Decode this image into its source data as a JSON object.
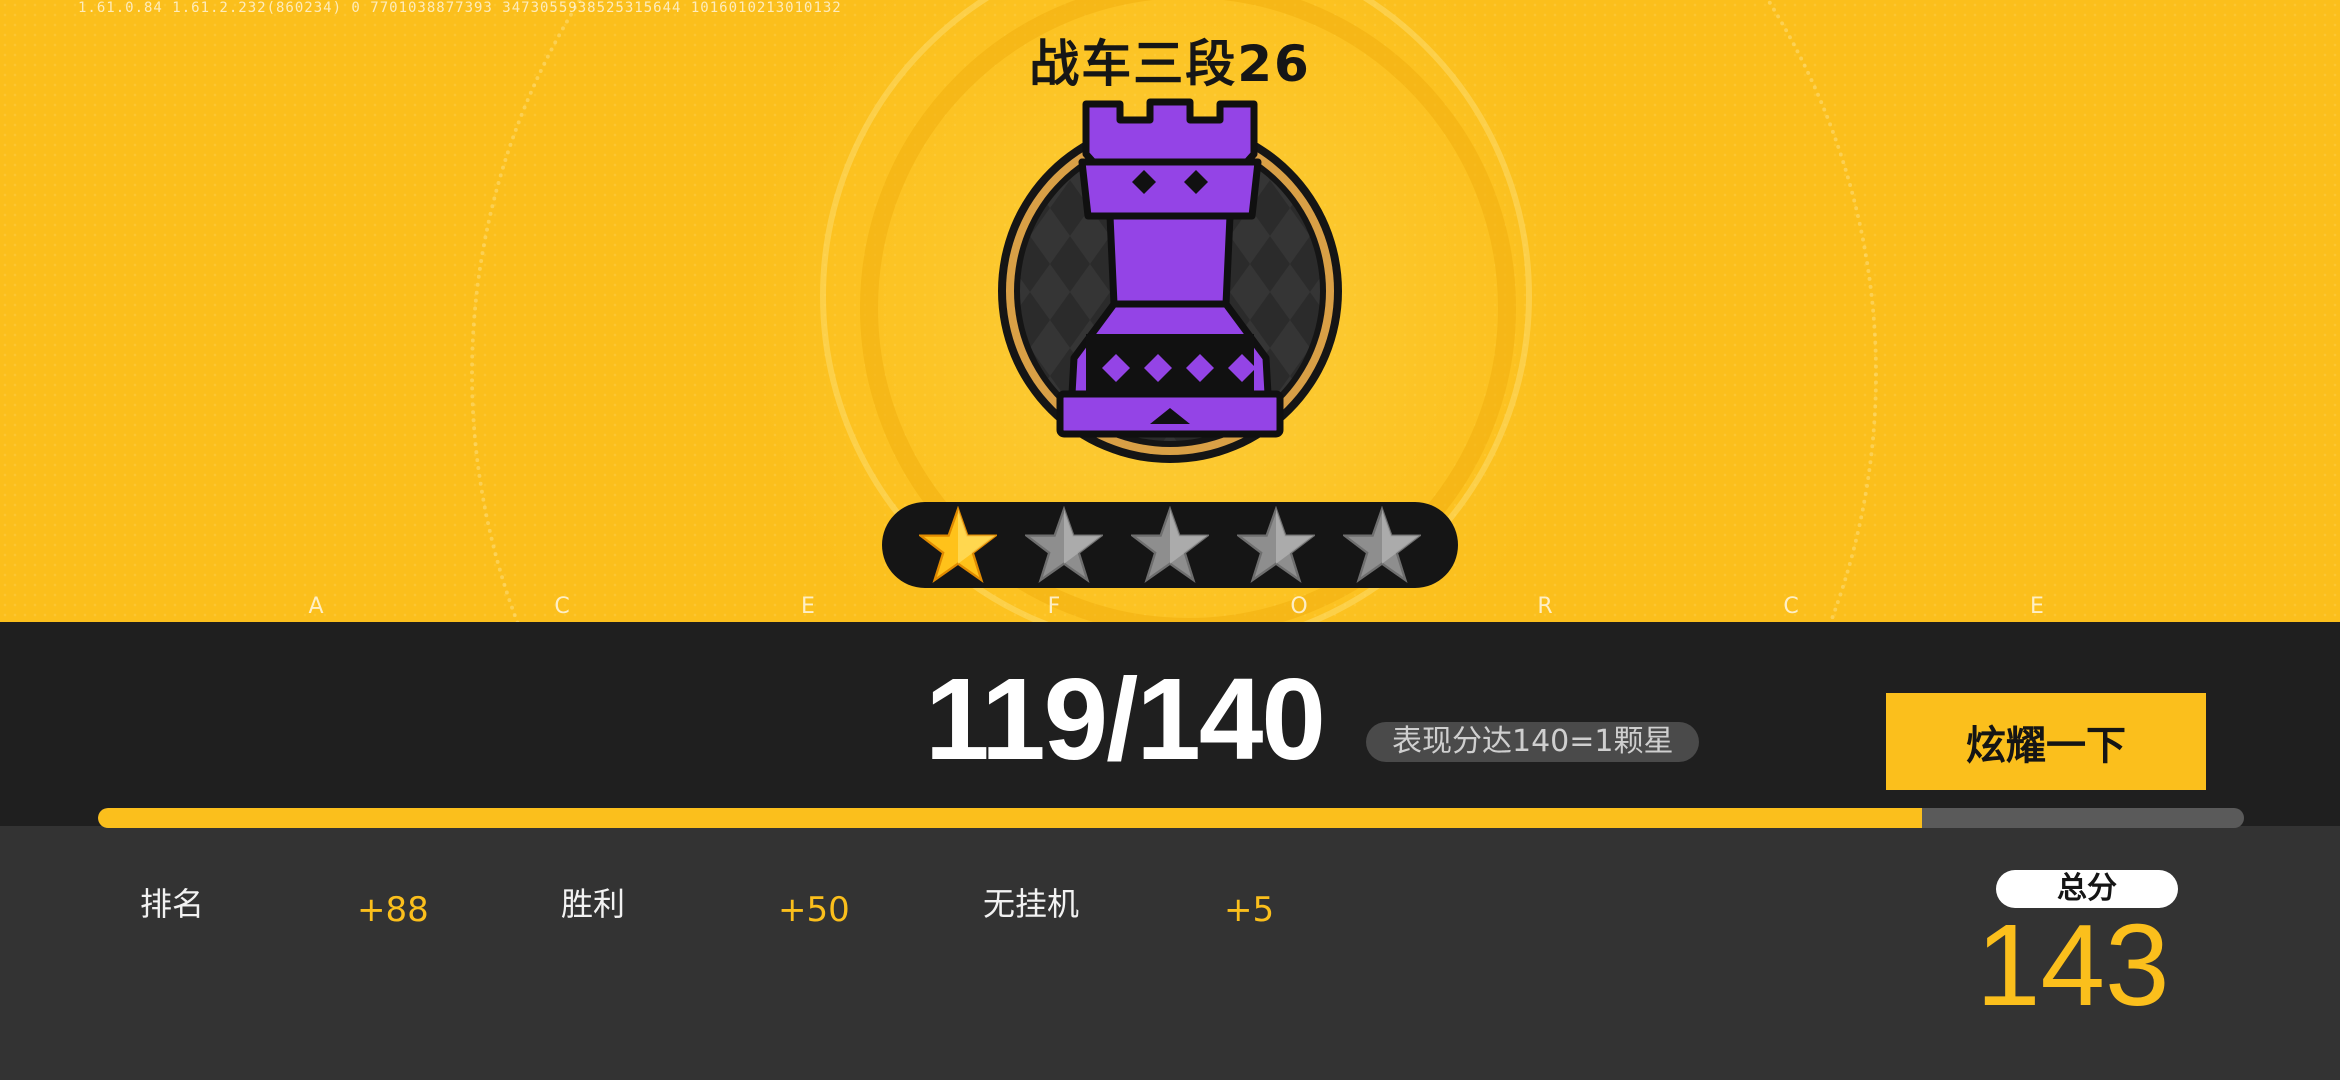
{
  "debug_text": "1.61.0.84  1.61.2.232(860234)  0  7701038877393  3473055938525315644  1016010213010132",
  "rank": {
    "title": "战车三段26",
    "emblem_icon": "purple-rook-chess-piece",
    "stars_total": 5,
    "stars_filled": 1
  },
  "background_letters": [
    "A",
    "C",
    "E",
    "F",
    "O",
    "R",
    "C",
    "E"
  ],
  "progress": {
    "score_text": "119/140",
    "current": 119,
    "target": 140,
    "hint": "表现分达140=1颗星",
    "fraction": 0.85
  },
  "show_button": {
    "label": "炫耀一下"
  },
  "breakdown": [
    {
      "label": "排名",
      "value": "+88"
    },
    {
      "label": "胜利",
      "value": "+50"
    },
    {
      "label": "无挂机",
      "value": "+5"
    }
  ],
  "total": {
    "label": "总分",
    "value": "143"
  },
  "colors": {
    "accent": "#FBBF1C",
    "emblem_purple": "#9444E6",
    "dark_band": "#1F1F1F",
    "bottom_panel": "#333333"
  }
}
